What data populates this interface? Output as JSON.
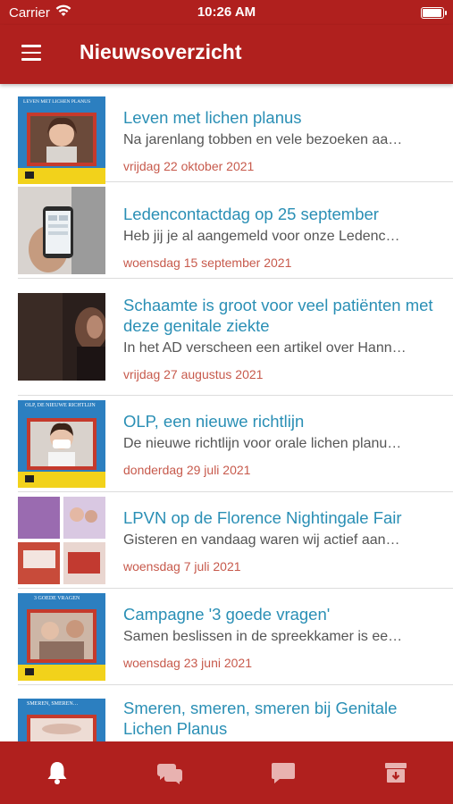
{
  "status_bar": {
    "carrier": "Carrier",
    "time": "10:26 AM"
  },
  "header": {
    "title": "Nieuwsoverzicht"
  },
  "news": [
    {
      "title": "Leven met lichen planus",
      "excerpt": "Na jarenlang tobben en vele bezoeken aa…",
      "date": "vrijdag 22 oktober 2021",
      "thumb_text": "LEVEN MET LICHEN PLANUS"
    },
    {
      "title": "Ledencontactdag op 25 september",
      "excerpt": "Heb jij je al aangemeld voor onze Ledenc…",
      "date": "woensdag 15 september 2021"
    },
    {
      "title": "Schaamte is groot voor veel patiënten met deze genitale ziekte",
      "excerpt": "In het AD verscheen een artikel over Hann…",
      "date": "vrijdag 27 augustus 2021"
    },
    {
      "title": "OLP, een nieuwe richtlijn",
      "excerpt": "De nieuwe richtlijn voor orale lichen planu…",
      "date": "donderdag 29 juli 2021",
      "thumb_text": "OLP, DE NIEUWE RICHTLIJN"
    },
    {
      "title": "LPVN op de Florence Nightingale Fair",
      "excerpt": "Gisteren en vandaag waren wij actief aan…",
      "date": "woensdag 7 juli 2021"
    },
    {
      "title": "Campagne '3 goede vragen'",
      "excerpt": "Samen beslissen in de spreekkamer is ee…",
      "date": "woensdag 23 juni 2021",
      "thumb_text": "3 GOEDE VRAGEN"
    },
    {
      "title": "Smeren, smeren, smeren bij Genitale Lichen Planus",
      "excerpt": "",
      "date": "",
      "thumb_text": "SMEREN, SMEREN…"
    }
  ],
  "tabs": [
    {
      "name": "bell-icon",
      "active": true
    },
    {
      "name": "chat-bubbles-icon",
      "active": false
    },
    {
      "name": "message-icon",
      "active": false
    },
    {
      "name": "archive-icon",
      "active": false
    }
  ],
  "colors": {
    "brand": "#b0201e",
    "title_link": "#2a8fb5",
    "date": "#c75a4c",
    "thumb_blue": "#2c7fc0",
    "thumb_yellow": "#f2d21b"
  }
}
